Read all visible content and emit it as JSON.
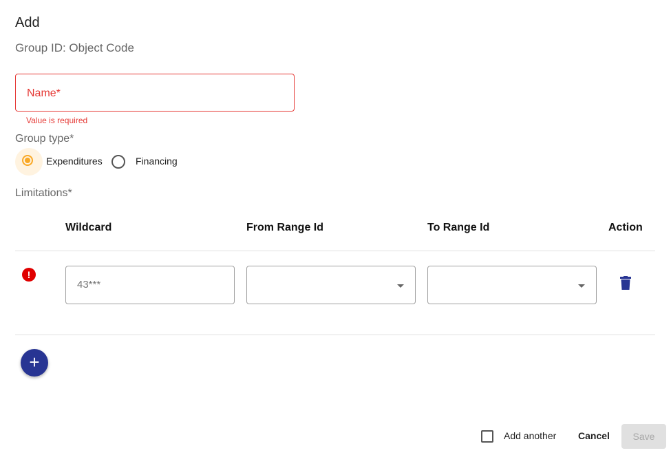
{
  "dialog": {
    "title": "Add",
    "subtitle": "Group ID: Object Code"
  },
  "name_field": {
    "label": "Name*",
    "error": "Value is required"
  },
  "group_type": {
    "label": "Group type*",
    "options": [
      {
        "label": "Expenditures",
        "selected": true
      },
      {
        "label": "Financing",
        "selected": false
      }
    ]
  },
  "limitations": {
    "label": "Limitations*",
    "columns": [
      "Wildcard",
      "From Range Id",
      "To Range Id",
      "Action"
    ],
    "rows": [
      {
        "wildcard_placeholder": "43***",
        "from_range": "",
        "to_range": "",
        "has_error": true
      }
    ]
  },
  "footer": {
    "add_another": "Add another",
    "cancel": "Cancel",
    "save": "Save"
  },
  "icons": {
    "error": "error-icon",
    "delete": "trash-icon",
    "add": "plus-icon",
    "dropdown": "caret-down-icon"
  },
  "colors": {
    "error": "#e53935",
    "radio_selected": "#f9a825",
    "primary": "#283593"
  }
}
